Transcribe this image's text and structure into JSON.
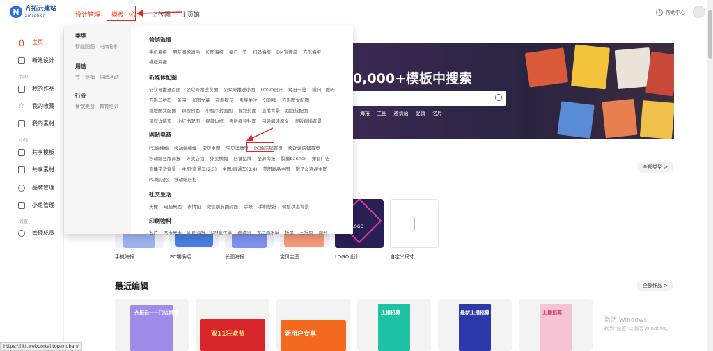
{
  "header": {
    "logo_name": "齐拓云建站",
    "logo_sub": "xmsq6.cn",
    "nav": [
      "设计管理",
      "模板中心",
      "上传图",
      "主页馆"
    ],
    "help": "帮助中心"
  },
  "sidebar": {
    "items": [
      {
        "label": "主页",
        "icon": "home-icon"
      },
      {
        "label": "新建设计",
        "icon": "new-file-icon"
      },
      {
        "label": "我的作品",
        "icon": "works-icon"
      },
      {
        "label": "我的收藏",
        "icon": "star-icon"
      },
      {
        "label": "我的素材",
        "icon": "image-icon"
      },
      {
        "label": "共享模板",
        "icon": "shared-template-icon"
      },
      {
        "label": "共享素材",
        "icon": "shared-material-icon"
      },
      {
        "label": "品牌管理",
        "icon": "brand-icon"
      },
      {
        "label": "小组管理",
        "icon": "group-icon"
      },
      {
        "label": "管理成员",
        "icon": "members-icon"
      }
    ],
    "groups": [
      "我的",
      "小组",
      "设置"
    ]
  },
  "dropdown": {
    "left": [
      {
        "title": "类型",
        "subs": [
          "智能配图",
          "电商物料"
        ]
      },
      {
        "title": "用途",
        "subs": [
          "节日促销",
          "招聘活动"
        ]
      },
      {
        "title": "行业",
        "subs": [
          "餐饮美食",
          "教育培训"
        ]
      }
    ],
    "sections": [
      {
        "title": "营销海报",
        "rows": [
          [
            "手机海报",
            "朋友圈邀请函",
            "长图海报",
            "每日一签",
            "扫码海报",
            "DM宣传单",
            "方形海报"
          ],
          [
            "横版海报"
          ]
        ]
      },
      {
        "title": "新媒体配图",
        "rows": [
          [
            "公众号推送首图",
            "公众号推送次图",
            "公众号推送小图",
            "LOGO设计",
            "每日一签",
            "横向二维码"
          ],
          [
            "方形二维码",
            "条漫",
            "长图文章",
            "在看提示",
            "引导关注",
            "分割线",
            "方形图文配图"
          ],
          [
            "横版图文配图",
            "课程封面",
            "小程序封面图",
            "视频封面",
            "直播背景",
            "超链接配图"
          ],
          [
            "课程详情页",
            "小红书配图",
            "视频边框",
            "竖版视频封面",
            "引导阅读原文",
            "竖版直播背景"
          ]
        ]
      },
      {
        "title": "网站电商",
        "rows": [
          [
            "PC端横幅",
            "移动端横幅",
            "宝贝主图",
            "宝贝详情页",
            "PC端店铺首页",
            "移动端店铺首页"
          ],
          [
            "移动端竖版海报",
            "外卖店招",
            "外卖横幅",
            "店铺招牌",
            "全屏海报",
            "胶囊banner",
            "弹窗广告"
          ],
          [
            "直播带货背景",
            "主图/直通车(2:3)",
            "主图/直通车(3:4)",
            "美团商品主图",
            "饿了么商品主图"
          ],
          [
            "PC端店招",
            "移动端店招"
          ]
        ]
      },
      {
        "title": "社交生活",
        "rows": [
          [
            "头像",
            "电脑桌面",
            "表情包",
            "微信朋友圈封面",
            "手帐",
            "手机壁纸",
            "微信状态背景"
          ]
        ]
      },
      {
        "title": "印刷物料",
        "rows": [
          [
            "名片",
            "席卡桌卡",
            "印刷海报",
            "DM宣传单",
            "邀请函",
            "食品酒水单",
            "折页",
            "三折页",
            "周刊"
          ]
        ]
      }
    ]
  },
  "banner": {
    "title": "0,000+模板中搜索",
    "tags": [
      "海报",
      "主图",
      "邀请函",
      "促销",
      "名片"
    ]
  },
  "buttons": {
    "all_types": "全部类型 >",
    "all_works": "全部作品 >"
  },
  "templates": [
    "手机海报",
    "PC端横幅",
    "长图海报",
    "宝贝主图",
    "LOGO设计",
    "自定义尺寸"
  ],
  "logo_card_text": "LOGO",
  "section_recent": "最近编辑",
  "recent": [
    {
      "text": "齐拓云——门店新客"
    },
    {
      "text": "双11狂欢节"
    },
    {
      "text": "新用户专享"
    },
    {
      "text": "主播招募"
    },
    {
      "text": "最新主播招募"
    },
    {
      "text": "主播招募"
    }
  ],
  "status_url": "https://l.kt.webportal.top/muban/",
  "watermark": [
    "激活 Windows",
    "转到\"设置\"以激活 Windows。"
  ]
}
